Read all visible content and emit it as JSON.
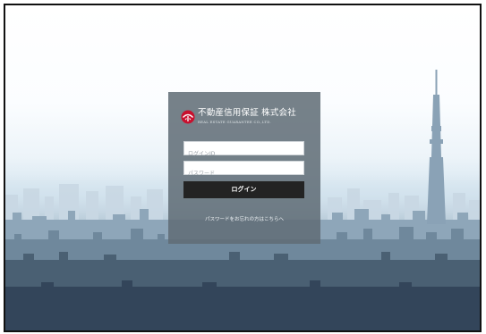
{
  "company": {
    "name": "不動産信用保証 株式会社",
    "name_en": "REAL ESTATE GUARANTEE CO.,LTD."
  },
  "login": {
    "id_placeholder": "ログインID",
    "password_placeholder": "パスワード",
    "submit_label": "ログイン",
    "forgot_link": "パスワードをお忘れの方はこちらへ"
  },
  "colors": {
    "panel": "#5f6c76",
    "button": "#232323",
    "logo_red": "#c8102e"
  },
  "icons": {
    "logo": "company-logo-icon"
  }
}
